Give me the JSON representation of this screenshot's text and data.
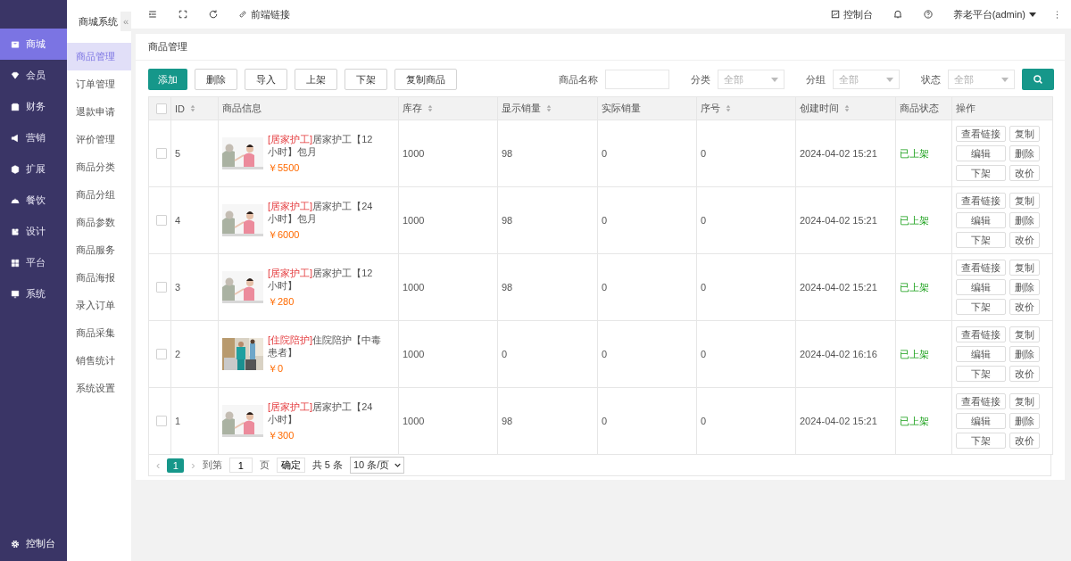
{
  "top_bar": {
    "frontend_link": "前端链接",
    "console": "控制台",
    "user": "养老平台(admin)"
  },
  "main_nav": {
    "items": [
      {
        "label": "商城",
        "selected": true
      },
      {
        "label": "会员",
        "selected": false
      },
      {
        "label": "财务",
        "selected": false
      },
      {
        "label": "营销",
        "selected": false
      },
      {
        "label": "扩展",
        "selected": false
      },
      {
        "label": "餐饮",
        "selected": false
      },
      {
        "label": "设计",
        "selected": false
      },
      {
        "label": "平台",
        "selected": false
      },
      {
        "label": "系统",
        "selected": false
      }
    ],
    "footer": "控制台"
  },
  "sub_nav": {
    "title": "商城系统",
    "collapse": "«",
    "items": [
      {
        "label": "商品管理",
        "selected": true
      },
      {
        "label": "订单管理",
        "selected": false
      },
      {
        "label": "退款申请",
        "selected": false
      },
      {
        "label": "评价管理",
        "selected": false
      },
      {
        "label": "商品分类",
        "selected": false
      },
      {
        "label": "商品分组",
        "selected": false
      },
      {
        "label": "商品参数",
        "selected": false
      },
      {
        "label": "商品服务",
        "selected": false
      },
      {
        "label": "商品海报",
        "selected": false
      },
      {
        "label": "录入订单",
        "selected": false
      },
      {
        "label": "商品采集",
        "selected": false
      },
      {
        "label": "销售统计",
        "selected": false
      },
      {
        "label": "系统设置",
        "selected": false
      }
    ]
  },
  "page_title": "商品管理",
  "toolbar": [
    {
      "label": "添加",
      "kind": "primary"
    },
    {
      "label": "删除",
      "kind": "default"
    },
    {
      "label": "导入",
      "kind": "default"
    },
    {
      "label": "上架",
      "kind": "default"
    },
    {
      "label": "下架",
      "kind": "default"
    },
    {
      "label": "复制商品",
      "kind": "default"
    }
  ],
  "filters": {
    "name_label": "商品名称",
    "selects": [
      {
        "label": "分类",
        "placeholder": "全部"
      },
      {
        "label": "分组",
        "placeholder": "全部"
      },
      {
        "label": "状态",
        "placeholder": "全部"
      }
    ]
  },
  "table": {
    "all_checked": false,
    "columns": [
      {
        "label": "ID",
        "sortable": true
      },
      {
        "label": "商品信息",
        "sortable": false
      },
      {
        "label": "库存",
        "sortable": true
      },
      {
        "label": "显示销量",
        "sortable": true
      },
      {
        "label": "实际销量",
        "sortable": false
      },
      {
        "label": "序号",
        "sortable": true
      },
      {
        "label": "创建时间",
        "sortable": true
      },
      {
        "label": "商品状态",
        "sortable": false
      },
      {
        "label": "操作",
        "sortable": false
      }
    ],
    "rows": [
      {
        "checked": false,
        "id": "5",
        "tag": "[居家护工]",
        "name": "居家护工【12小时】包月",
        "price": "￥5500",
        "stock": "1000",
        "shown_sales": "98",
        "actual_sales": "0",
        "order": "0",
        "created": "2024-04-02 15:21",
        "status": "已上架",
        "actions": [
          "查看链接",
          "复制",
          "编辑",
          "删除",
          "下架",
          "改价"
        ]
      },
      {
        "checked": false,
        "id": "4",
        "tag": "[居家护工]",
        "name": "居家护工【24小时】包月",
        "price": "￥6000",
        "stock": "1000",
        "shown_sales": "98",
        "actual_sales": "0",
        "order": "0",
        "created": "2024-04-02 15:21",
        "status": "已上架",
        "actions": [
          "查看链接",
          "复制",
          "编辑",
          "删除",
          "下架",
          "改价"
        ]
      },
      {
        "checked": false,
        "id": "3",
        "tag": "[居家护工]",
        "name": "居家护工【12小时】",
        "price": "￥280",
        "stock": "1000",
        "shown_sales": "98",
        "actual_sales": "0",
        "order": "0",
        "created": "2024-04-02 15:21",
        "status": "已上架",
        "actions": [
          "查看链接",
          "复制",
          "编辑",
          "删除",
          "下架",
          "改价"
        ]
      },
      {
        "checked": false,
        "id": "2",
        "tag": "[住院陪护]",
        "name": "住院陪护【中毒患者】",
        "price": "￥0",
        "stock": "1000",
        "shown_sales": "0",
        "actual_sales": "0",
        "order": "0",
        "created": "2024-04-02 16:16",
        "status": "已上架",
        "actions": [
          "查看链接",
          "复制",
          "编辑",
          "删除",
          "下架",
          "改价"
        ]
      },
      {
        "checked": false,
        "id": "1",
        "tag": "[居家护工]",
        "name": "居家护工【24小时】",
        "price": "￥300",
        "stock": "1000",
        "shown_sales": "98",
        "actual_sales": "0",
        "order": "0",
        "created": "2024-04-02 15:21",
        "status": "已上架",
        "actions": [
          "查看链接",
          "复制",
          "编辑",
          "删除",
          "下架",
          "改价"
        ]
      }
    ]
  },
  "pagination": {
    "prev": "‹",
    "page": "1",
    "next": "›",
    "goto_label": "到第",
    "goto_value": "1",
    "page_unit": "页",
    "confirm": "确定",
    "total": "共 5 条",
    "page_size": "10 条/页"
  }
}
